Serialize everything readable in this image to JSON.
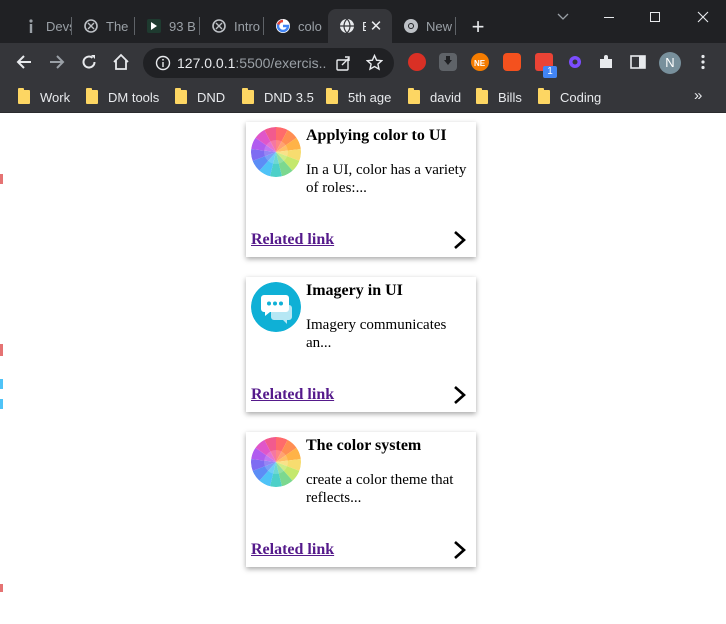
{
  "browser": {
    "tabs": [
      {
        "label": "Devs",
        "icon": "info-icon"
      },
      {
        "label": "The",
        "icon": "openai-logo-icon"
      },
      {
        "label": "93 B",
        "icon": "app-icon"
      },
      {
        "label": "Intro",
        "icon": "openai-logo-icon"
      },
      {
        "label": "colo",
        "icon": "google-icon"
      },
      {
        "label": "E",
        "icon": "globe-icon",
        "active": true
      },
      {
        "label": "New",
        "icon": "chrome-icon"
      }
    ],
    "url_host": "127.0.0.1",
    "url_rest": ":5500/exercis...",
    "extension_badge": "1",
    "profile_initial": "N",
    "bookmarks": [
      "Work",
      "DM tools",
      "DND",
      "DND 3.5",
      "5th age",
      "david",
      "Bills",
      "Coding"
    ]
  },
  "cards": [
    {
      "title": "Applying color to UI",
      "description": "In a UI, color has a variety of roles:...",
      "link": "Related link",
      "image": "color-wheel-icon"
    },
    {
      "title": "Imagery in UI",
      "description": "Imagery communicates an...",
      "link": "Related link",
      "image": "chat-bubbles-icon"
    },
    {
      "title": "The color system",
      "description": "create a color theme that reflects...",
      "link": "Related link",
      "image": "color-wheel-icon"
    }
  ]
}
